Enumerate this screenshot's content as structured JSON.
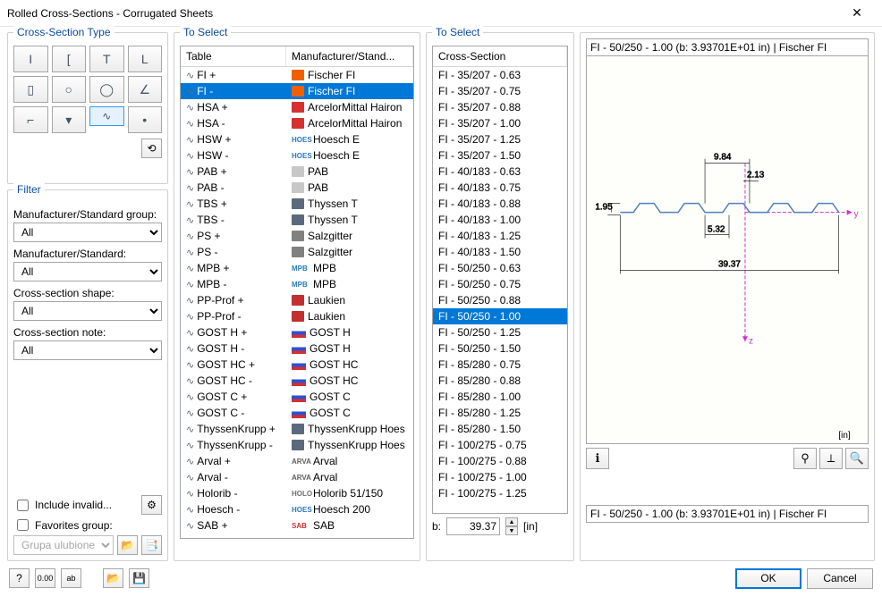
{
  "window": {
    "title": "Rolled Cross-Sections - Corrugated Sheets"
  },
  "groups": {
    "type": "Cross-Section Type",
    "filter": "Filter",
    "toSelect1": "To Select",
    "toSelect2": "To Select"
  },
  "cols": {
    "table": "Table",
    "mfr": "Manufacturer/Stand...",
    "cross": "Cross-Section"
  },
  "filter": {
    "mfrGroup": "Manufacturer/Standard group:",
    "mfr": "Manufacturer/Standard:",
    "shape": "Cross-section shape:",
    "note": "Cross-section note:",
    "all": "All",
    "includeInvalid": "Include invalid...",
    "favGroup": "Favorites group:",
    "favGroupVal": "Grupa ulubione"
  },
  "bLabel": "b:",
  "bValue": "39.37",
  "unit": "[in]",
  "previewTitle": "FI - 50/250 - 1.00 (b: 3.93701E+01 in) | Fischer FI",
  "descText": "FI - 50/250 - 1.00 (b: 3.93701E+01 in) | Fischer FI",
  "dims": {
    "a": "9.84",
    "b": "2.13",
    "c": "1.95",
    "d": "5.32",
    "e": "39.37"
  },
  "buttons": {
    "ok": "OK",
    "cancel": "Cancel"
  },
  "tableRows": [
    {
      "t": "FI +",
      "m": "Fischer FI",
      "c": "#f06000"
    },
    {
      "t": "FI -",
      "m": "Fischer FI",
      "c": "#f06000",
      "sel": true
    },
    {
      "t": "HSA +",
      "m": "ArcelorMittal Hairon",
      "c": "#d63030"
    },
    {
      "t": "HSA -",
      "m": "ArcelorMittal Hairon",
      "c": "#d63030"
    },
    {
      "t": "HSW +",
      "m": "Hoesch E",
      "c": "#2a7ac0",
      "txt": true
    },
    {
      "t": "HSW -",
      "m": "Hoesch E",
      "c": "#2a7ac0",
      "txt": true
    },
    {
      "t": "PAB +",
      "m": "PAB",
      "c": "#c8c8c8"
    },
    {
      "t": "PAB -",
      "m": "PAB",
      "c": "#c8c8c8"
    },
    {
      "t": "TBS +",
      "m": "Thyssen T",
      "c": "#5a6a7a"
    },
    {
      "t": "TBS -",
      "m": "Thyssen T",
      "c": "#5a6a7a"
    },
    {
      "t": "PS +",
      "m": "Salzgitter",
      "c": "#808080"
    },
    {
      "t": "PS -",
      "m": "Salzgitter",
      "c": "#808080"
    },
    {
      "t": "MPB +",
      "m": "MPB",
      "c": "#2a7ac0",
      "txt": true
    },
    {
      "t": "MPB -",
      "m": "MPB",
      "c": "#2a7ac0",
      "txt": true
    },
    {
      "t": "PP-Prof +",
      "m": "Laukien",
      "c": "#c03030"
    },
    {
      "t": "PP-Prof -",
      "m": "Laukien",
      "c": "#c03030"
    },
    {
      "t": "GOST H +",
      "m": "GOST H",
      "c": "#3050d0",
      "flag": true
    },
    {
      "t": "GOST H -",
      "m": "GOST H",
      "c": "#3050d0",
      "flag": true
    },
    {
      "t": "GOST HC +",
      "m": "GOST HC",
      "c": "#3050d0",
      "flag": true
    },
    {
      "t": "GOST HC -",
      "m": "GOST HC",
      "c": "#3050d0",
      "flag": true
    },
    {
      "t": "GOST C +",
      "m": "GOST C",
      "c": "#3050d0",
      "flag": true
    },
    {
      "t": "GOST C -",
      "m": "GOST C",
      "c": "#3050d0",
      "flag": true
    },
    {
      "t": "ThyssenKrupp +",
      "m": "ThyssenKrupp Hoes",
      "c": "#5a6a7a"
    },
    {
      "t": "ThyssenKrupp -",
      "m": "ThyssenKrupp Hoes",
      "c": "#5a6a7a"
    },
    {
      "t": "Arval +",
      "m": "Arval",
      "c": "#606060",
      "txt": true
    },
    {
      "t": "Arval -",
      "m": "Arval",
      "c": "#606060",
      "txt": true
    },
    {
      "t": "Holorib -",
      "m": "Holorib 51/150",
      "c": "#707070",
      "txt": true
    },
    {
      "t": "Hoesch -",
      "m": "Hoesch 200",
      "c": "#2a7ac0",
      "txt": true
    },
    {
      "t": "SAB +",
      "m": "SAB",
      "c": "#d03030",
      "txt": true
    }
  ],
  "crossRows": [
    "FI - 35/207 - 0.63",
    "FI - 35/207 - 0.75",
    "FI - 35/207 - 0.88",
    "FI - 35/207 - 1.00",
    "FI - 35/207 - 1.25",
    "FI - 35/207 - 1.50",
    "FI - 40/183 - 0.63",
    "FI - 40/183 - 0.75",
    "FI - 40/183 - 0.88",
    "FI - 40/183 - 1.00",
    "FI - 40/183 - 1.25",
    "FI - 40/183 - 1.50",
    "FI - 50/250 - 0.63",
    "FI - 50/250 - 0.75",
    "FI - 50/250 - 0.88",
    {
      "v": "FI - 50/250 - 1.00",
      "sel": true
    },
    "FI - 50/250 - 1.25",
    "FI - 50/250 - 1.50",
    "FI - 85/280 - 0.75",
    "FI - 85/280 - 0.88",
    "FI - 85/280 - 1.00",
    "FI - 85/280 - 1.25",
    "FI - 85/280 - 1.50",
    "FI - 100/275 - 0.75",
    "FI - 100/275 - 0.88",
    "FI - 100/275 - 1.00",
    "FI - 100/275 - 1.25"
  ],
  "typeIcons": [
    "I",
    "[",
    "T",
    "L",
    "▯",
    "○",
    "◯",
    "∠",
    "⌐",
    "▾",
    "∿",
    "•"
  ]
}
